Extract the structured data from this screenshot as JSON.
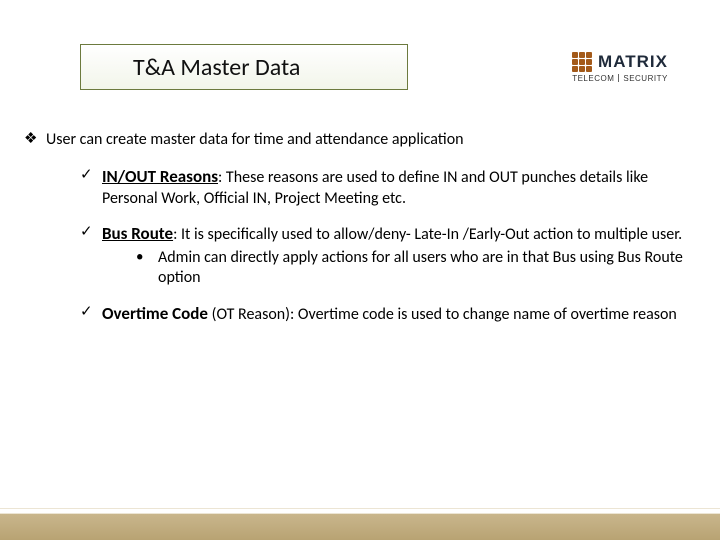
{
  "header": {
    "title": "T&A Master Data",
    "logo": {
      "brand": "MATRIX",
      "sub_left": "TELECOM",
      "sub_right": "SECURITY"
    }
  },
  "body": {
    "level1": {
      "bullet_glyph": "❖",
      "text": "User can create master data for time and attendance application"
    },
    "items": [
      {
        "check": "✓",
        "lead": "IN/OUT Reasons",
        "lead_sep": ": ",
        "text": "These reasons are used to define IN and OUT punches details like Personal Work, Official IN, Project Meeting etc."
      },
      {
        "check": "✓",
        "lead": "Bus Route",
        "lead_sep": ": ",
        "text": "It is specifically used to allow/deny- Late-In /Early-Out action to multiple user.",
        "sub": {
          "bullet": "•",
          "text": "Admin can directly apply actions for all users who are in that Bus using Bus Route option"
        }
      },
      {
        "check": "✓",
        "lead": "Overtime Code",
        "lead_sep": " ",
        "paren": "(OT Reason): ",
        "text": "Overtime code is used to change name of overtime reason"
      }
    ]
  }
}
